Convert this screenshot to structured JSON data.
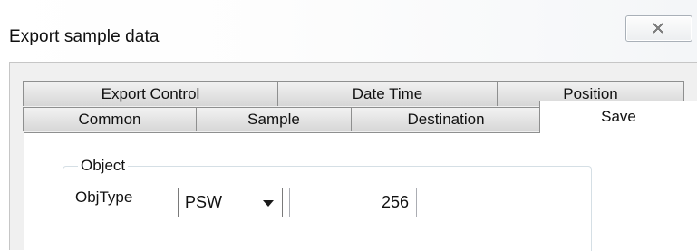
{
  "window": {
    "title": "Export sample data",
    "close_icon": "close-icon"
  },
  "tabs": {
    "row1": [
      {
        "label": "Export Control"
      },
      {
        "label": "Date Time"
      },
      {
        "label": "Position"
      }
    ],
    "row2": [
      {
        "label": "Common"
      },
      {
        "label": "Sample"
      },
      {
        "label": "Destination"
      },
      {
        "label": "Save",
        "active": true
      }
    ]
  },
  "object_group": {
    "legend": "Object",
    "objtype_label": "ObjType",
    "objtype_selected": "PSW",
    "address_value": "256"
  },
  "colors": {
    "tab_border": "#8e8f8f",
    "active_tab": "#ffffff",
    "dialog_bg": "#f0f0f0"
  }
}
